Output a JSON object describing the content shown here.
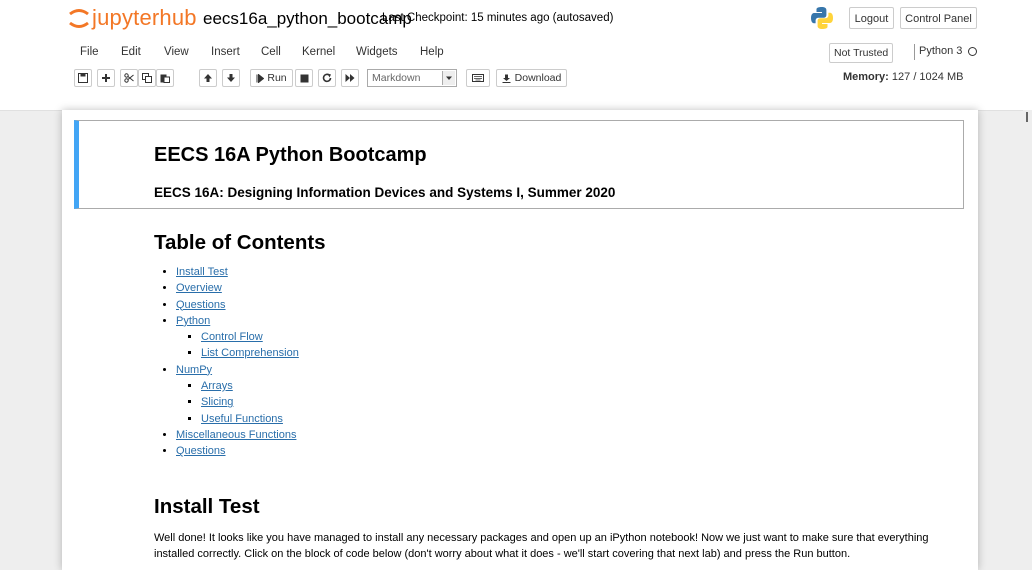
{
  "header": {
    "logo_text": "jupyterhub",
    "notebook_name": "eecs16a_python_bootcamp",
    "checkpoint": "Last Checkpoint: 15 minutes ago  (autosaved)",
    "logout": "Logout",
    "control_panel": "Control Panel"
  },
  "menu": {
    "items": [
      "File",
      "Edit",
      "View",
      "Insert",
      "Cell",
      "Kernel",
      "Widgets",
      "Help"
    ],
    "not_trusted": "Not Trusted",
    "kernel": "Python 3"
  },
  "toolbar": {
    "run": "Run",
    "cell_type": "Markdown",
    "download": "Download",
    "memory_label": "Memory:",
    "memory_value": "127 / 1024 MB"
  },
  "notebook": {
    "title": "EECS 16A Python Bootcamp",
    "subtitle": "EECS 16A: Designing Information Devices and Systems I, Summer 2020",
    "toc_heading": "Table of Contents",
    "toc": [
      {
        "label": "Install Test",
        "children": []
      },
      {
        "label": "Overview",
        "children": []
      },
      {
        "label": "Questions",
        "children": []
      },
      {
        "label": "Python",
        "children": [
          "Control Flow",
          "List Comprehension"
        ]
      },
      {
        "label": "NumPy",
        "children": [
          "Arrays",
          "Slicing",
          "Useful Functions"
        ]
      },
      {
        "label": "Miscellaneous Functions",
        "children": []
      },
      {
        "label": "Questions",
        "children": []
      }
    ],
    "install_heading": "Install Test",
    "install_text": "Well done! It looks like you have managed to install any necessary packages and open up an iPython notebook! Now we just want to make sure that everything installed correctly. Click on the block of code below (don't worry about what it does - we'll start covering that next lab) and press the Run button."
  },
  "colors": {
    "accent_orange": "#f37726",
    "cell_border_blue": "#42a5f5",
    "link": "#296eaa"
  }
}
